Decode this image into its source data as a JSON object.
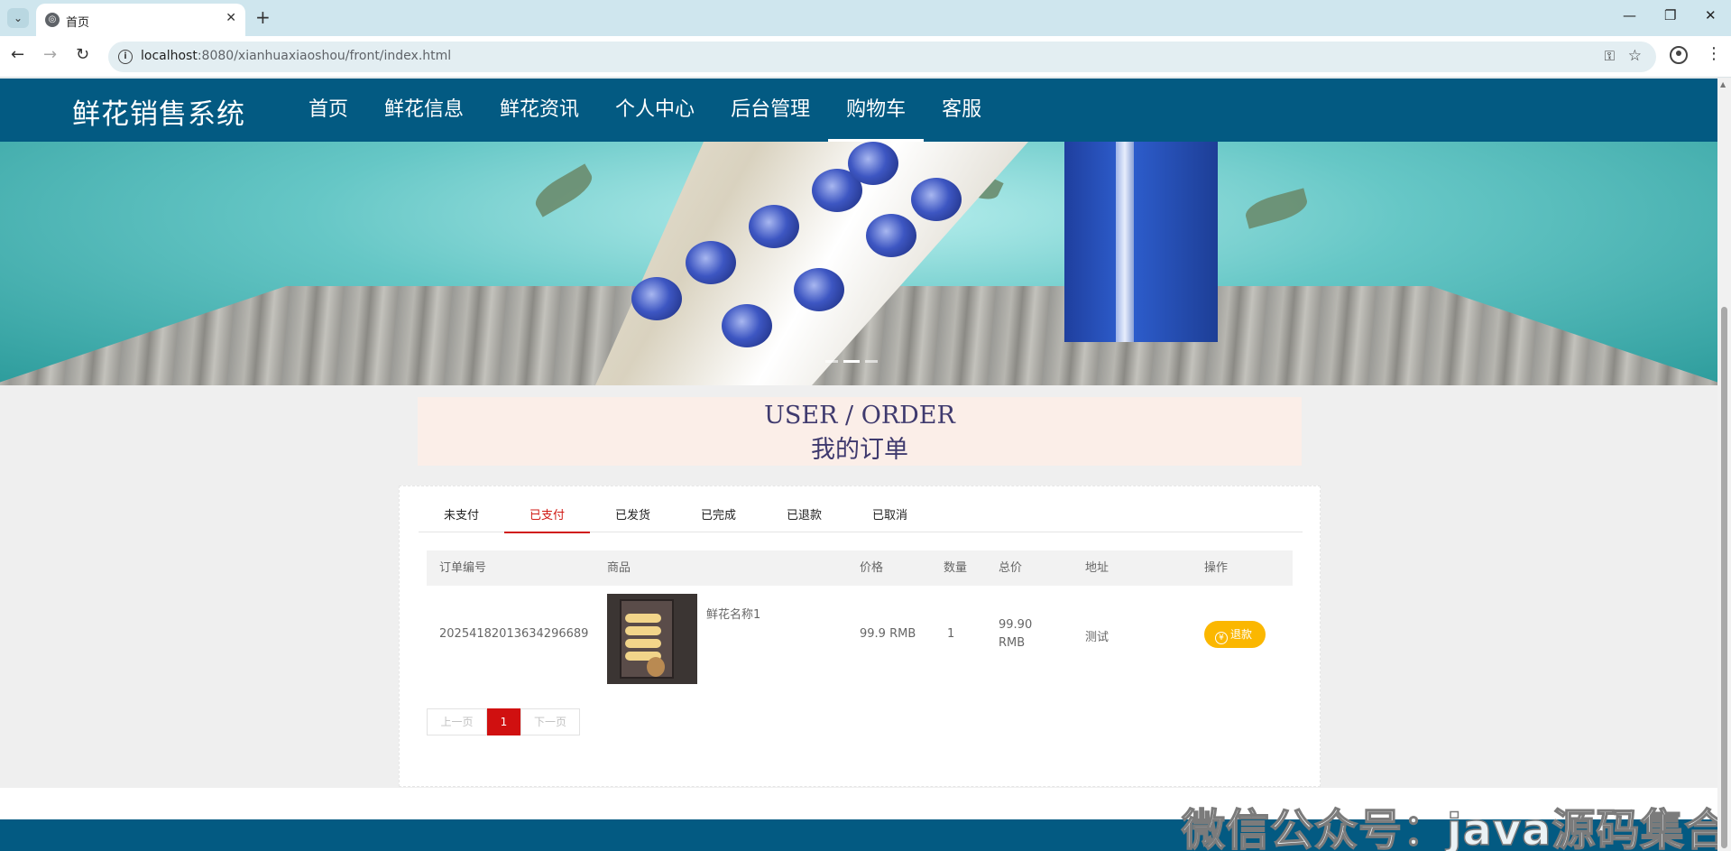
{
  "browser": {
    "tab_title": "首页",
    "url_host": "localhost",
    "url_rest": ":8080/xianhuaxiaoshou/front/index.html"
  },
  "site": {
    "logo": "鲜花销售系统",
    "menu": [
      {
        "label": "首页"
      },
      {
        "label": "鲜花信息"
      },
      {
        "label": "鲜花资讯"
      },
      {
        "label": "个人中心"
      },
      {
        "label": "后台管理"
      },
      {
        "label": "购物车",
        "active": true
      },
      {
        "label": "客服"
      }
    ]
  },
  "page": {
    "title_en": "USER / ORDER",
    "title_cn": "我的订单"
  },
  "order_tabs": [
    {
      "label": "未支付"
    },
    {
      "label": "已支付",
      "active": true
    },
    {
      "label": "已发货"
    },
    {
      "label": "已完成"
    },
    {
      "label": "已退款"
    },
    {
      "label": "已取消"
    }
  ],
  "table": {
    "headers": {
      "order_no": "订单编号",
      "product": "商品",
      "price": "价格",
      "qty": "数量",
      "total": "总价",
      "address": "地址",
      "action": "操作"
    },
    "rows": [
      {
        "order_no": "20254182013634296689",
        "product_name": "鲜花名称1",
        "price": "99.9 RMB",
        "qty": "1",
        "total_num": "99.90",
        "total_unit": "RMB",
        "address": "测试",
        "action_icon": "¥",
        "action_label": "退款"
      }
    ]
  },
  "pager": {
    "prev": "上一页",
    "current": "1",
    "next": "下一页"
  },
  "watermark": "微信公众号：java源码集合",
  "colors": {
    "nav_bg": "#035a82",
    "active_tab": "#d01a14",
    "refund_btn": "#fbb700",
    "title_box": "#fbeee8"
  }
}
